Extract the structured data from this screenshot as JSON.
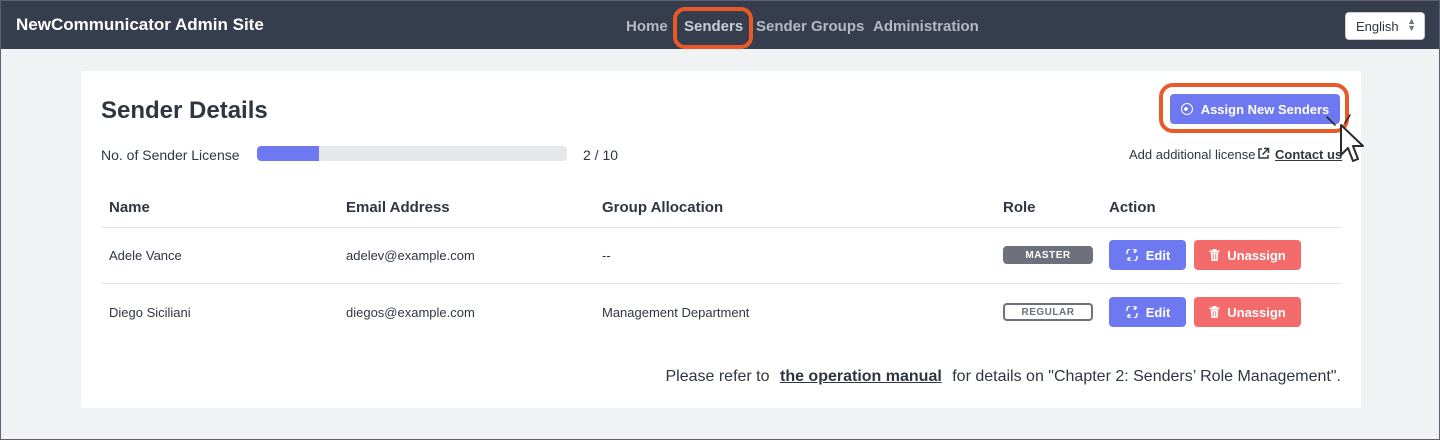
{
  "app": {
    "title": "NewCommunicator Admin Site"
  },
  "nav": {
    "items": [
      {
        "label": "Home"
      },
      {
        "label": "Senders"
      },
      {
        "label": "Sender Groups"
      },
      {
        "label": "Administration"
      }
    ],
    "active": "Senders"
  },
  "language": {
    "selected": "English"
  },
  "details": {
    "title": "Sender Details",
    "license_label": "No. of Sender License",
    "license_used": 2,
    "license_total": 10,
    "license_count_text": "2 / 10",
    "assign_button": "Assign New Senders",
    "additional_text": "Add additional license",
    "contact_link": "Contact us"
  },
  "table": {
    "headers": [
      "Name",
      "Email Address",
      "Group Allocation",
      "Role",
      "Action"
    ],
    "rows": [
      {
        "name": "Adele Vance",
        "email": "adelev@example.com",
        "group": "--",
        "role": "MASTER",
        "edit": "Edit",
        "unassign": "Unassign"
      },
      {
        "name": "Diego Siciliani",
        "email": "diegos@example.com",
        "group": "Management Department",
        "role": "REGULAR",
        "edit": "Edit",
        "unassign": "Unassign"
      }
    ]
  },
  "footer": {
    "prefix": "Please refer to",
    "link": "the operation manual",
    "suffix": "for details on \"Chapter 2: Senders’ Role Management\"."
  },
  "colors": {
    "navbar": "#363d4c",
    "accent": "#6e78f0",
    "danger": "#f46b6b",
    "highlight": "#ea5a28",
    "badge": "#6d717b"
  },
  "icons": {
    "assign": "plus-circle-icon",
    "external": "external-link-icon",
    "edit": "swap-arrows-icon",
    "unassign": "trash-icon",
    "cursor": "mouse-pointer-icon"
  }
}
